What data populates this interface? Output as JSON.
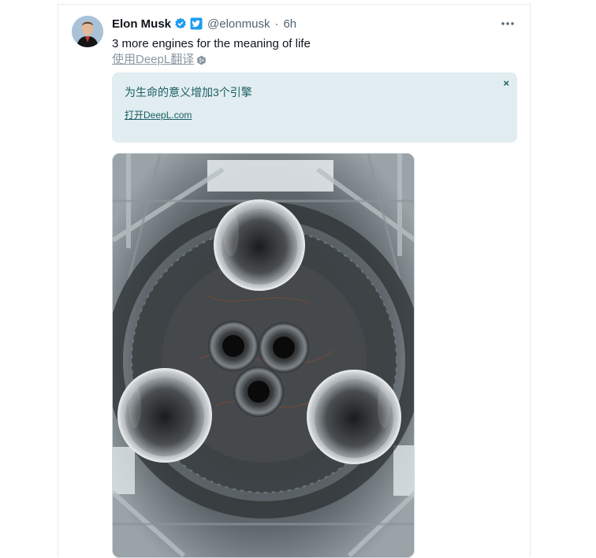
{
  "tweet": {
    "author_name": "Elon Musk",
    "author_handle": "@elonmusk",
    "separator": "·",
    "time": "6h",
    "text": "3 more engines for the meaning of life",
    "translate_label": "使用DeepL翻译",
    "verified_icon": "verified-badge-icon",
    "deepl_icon": "deepl-icon"
  },
  "deepl": {
    "translation": "为生命的意义增加3个引擎",
    "open_link": "打开DeepL.com",
    "close": "×"
  },
  "colors": {
    "accent": "#1d9bf0",
    "deepl_bg": "#e1edf0",
    "deepl_text": "#1a5e63",
    "muted": "#536471"
  }
}
